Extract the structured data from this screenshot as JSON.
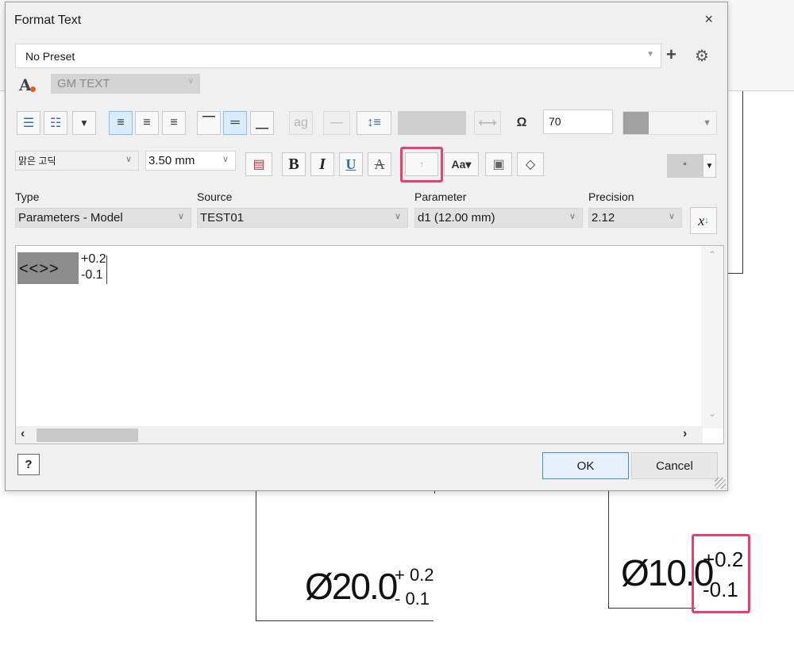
{
  "dialog": {
    "title": "Format Text",
    "close": "×",
    "preset": "No Preset",
    "style_name": "GM TEXT",
    "spacing_value": "70",
    "font": "맑은 고딕",
    "size": "3.50 mm",
    "bold": "B",
    "italic": "I",
    "underline": "U",
    "strike": "A",
    "stack": "↑",
    "symbol": "°",
    "type_label": "Type",
    "type_value": "Parameters - Model",
    "source_label": "Source",
    "source_value": "TEST01",
    "parameter_label": "Parameter",
    "parameter_value": "d1 (12.00 mm)",
    "precision_label": "Precision",
    "precision_value": "2.12",
    "editor": {
      "parameter_tag": "<<>>",
      "tol_upper": "+0.2",
      "tol_lower": "-0.1"
    },
    "help": "?",
    "ok": "OK",
    "cancel": "Cancel"
  },
  "drawing": {
    "dim1_main": "Ø20.0",
    "dim1_upper": "+ 0.2",
    "dim1_lower": "- 0.1",
    "dim2_main": "Ø10.0",
    "dim2_upper": "+0.2",
    "dim2_lower": "-0.1"
  },
  "colors": {
    "highlight": "#e8416b",
    "accent": "#2b6cc0"
  }
}
